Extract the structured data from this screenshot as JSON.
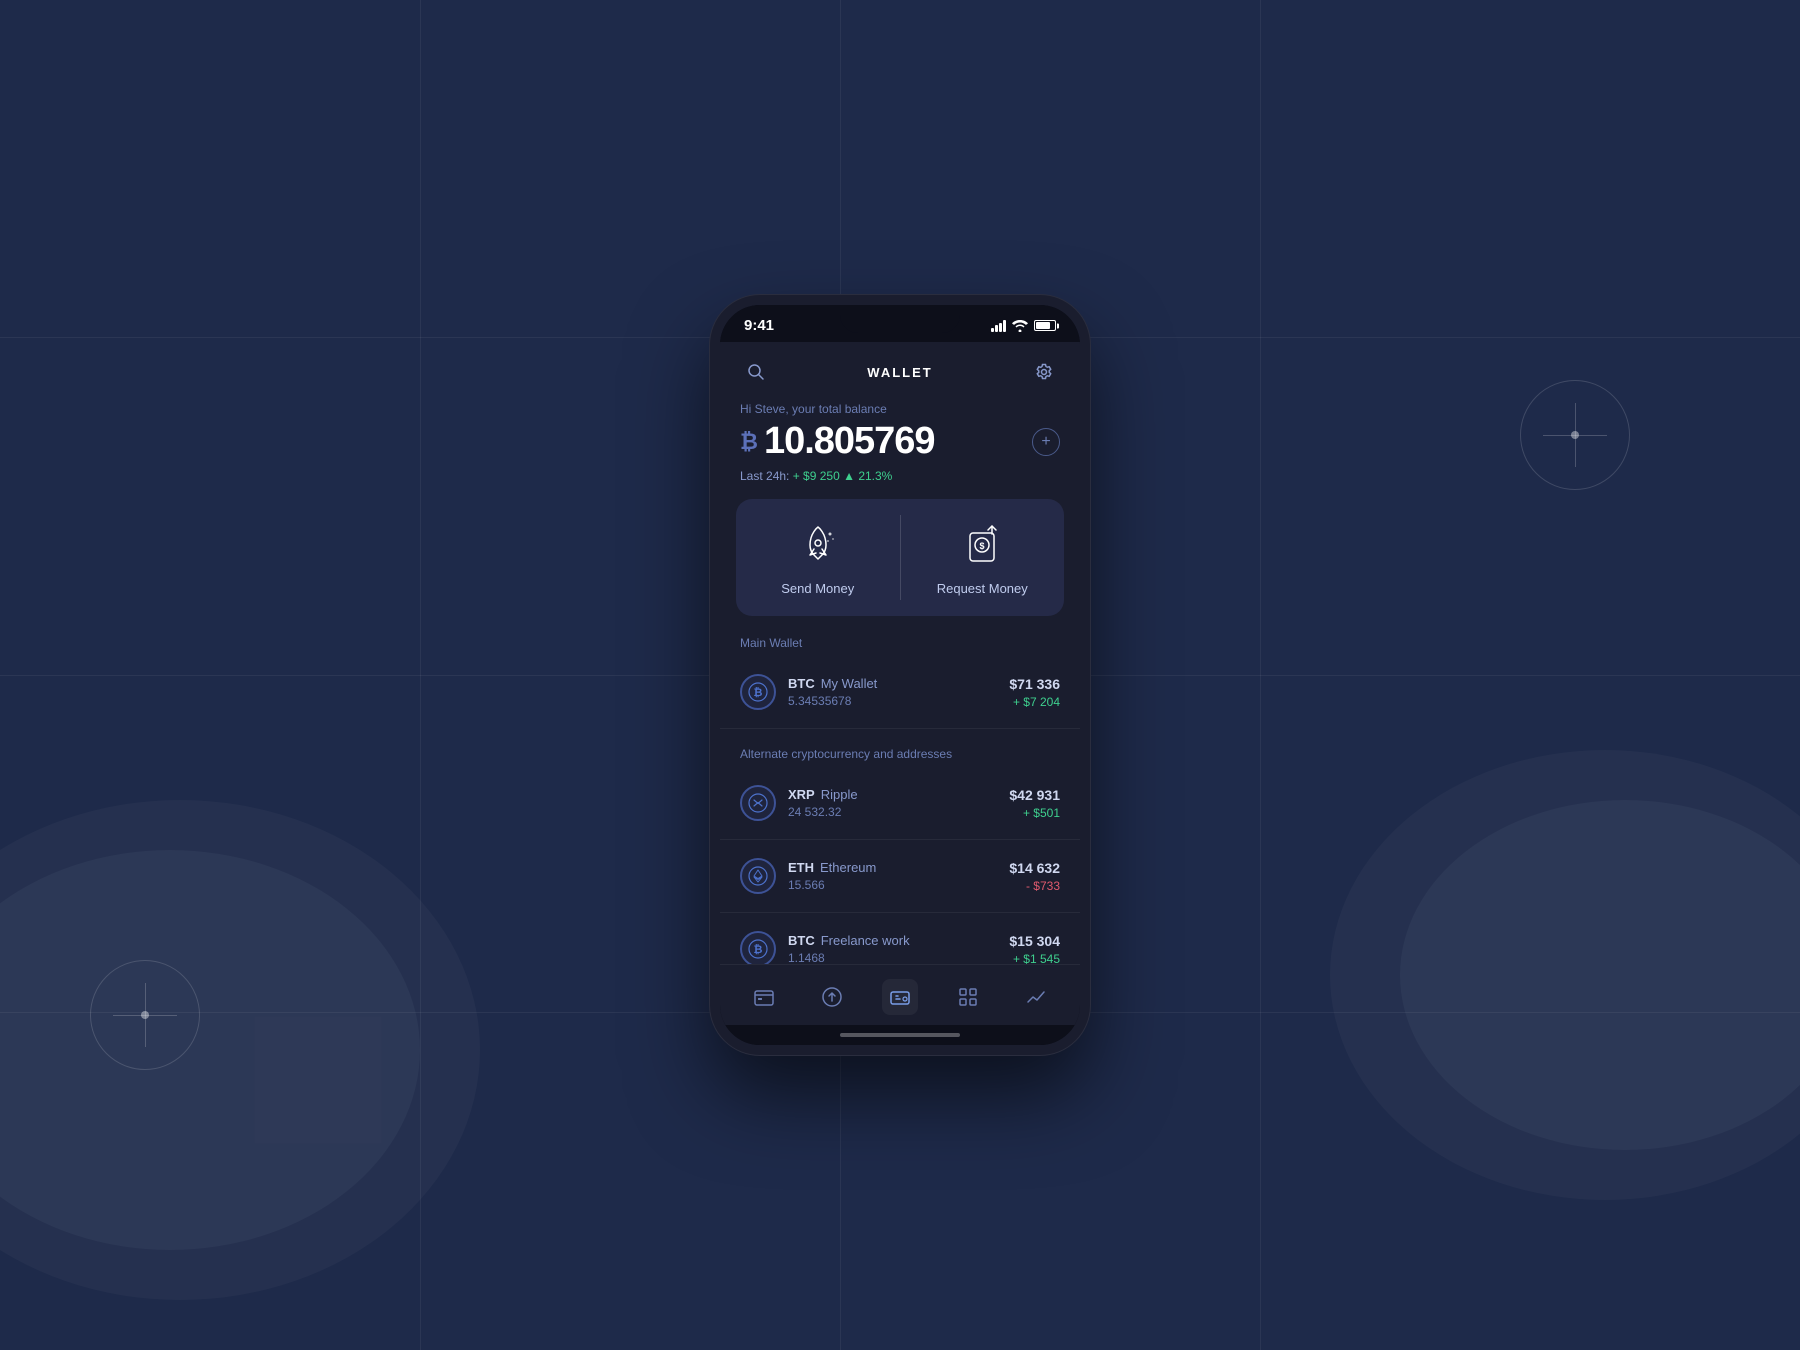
{
  "background": {
    "color": "#1e2a4a"
  },
  "status_bar": {
    "time": "9:41",
    "signal": "strong",
    "wifi": true,
    "battery_level": "75"
  },
  "header": {
    "title": "WALLET",
    "search_label": "search",
    "settings_label": "settings"
  },
  "balance": {
    "greeting": "Hi Steve, your total balance",
    "amount": "10.805769",
    "currency_symbol": "₿",
    "change_label": "Last 24h:",
    "change_amount": "+ $9 250",
    "change_percent": "21.3%",
    "add_button_label": "add"
  },
  "actions": {
    "send": {
      "label": "Send Money",
      "icon": "rocket-icon"
    },
    "request": {
      "label": "Request Money",
      "icon": "request-icon"
    }
  },
  "main_wallet_section": {
    "label": "Main Wallet",
    "items": [
      {
        "ticker": "BTC",
        "name": "My Wallet",
        "amount": "5.34535678",
        "usd_value": "$71 336",
        "change": "+ $7 204",
        "change_type": "positive",
        "icon": "btc-icon"
      }
    ]
  },
  "alt_wallet_section": {
    "label": "Alternate cryptocurrency and addresses",
    "items": [
      {
        "ticker": "XRP",
        "name": "Ripple",
        "amount": "24 532.32",
        "usd_value": "$42 931",
        "change": "+ $501",
        "change_type": "positive",
        "icon": "xrp-icon"
      },
      {
        "ticker": "ETH",
        "name": "Ethereum",
        "amount": "15.566",
        "usd_value": "$14 632",
        "change": "- $733",
        "change_type": "negative",
        "icon": "eth-icon"
      },
      {
        "ticker": "BTC",
        "name": "Freelance work",
        "amount": "1.1468",
        "usd_value": "$15 304",
        "change": "+ $1 545",
        "change_type": "positive",
        "icon": "btc-icon"
      }
    ]
  },
  "bottom_nav": {
    "items": [
      {
        "id": "wallet",
        "label": "wallet",
        "active": false
      },
      {
        "id": "send",
        "label": "send",
        "active": false
      },
      {
        "id": "cards",
        "label": "cards",
        "active": true
      },
      {
        "id": "grid",
        "label": "grid",
        "active": false
      },
      {
        "id": "chart",
        "label": "chart",
        "active": false
      }
    ]
  }
}
